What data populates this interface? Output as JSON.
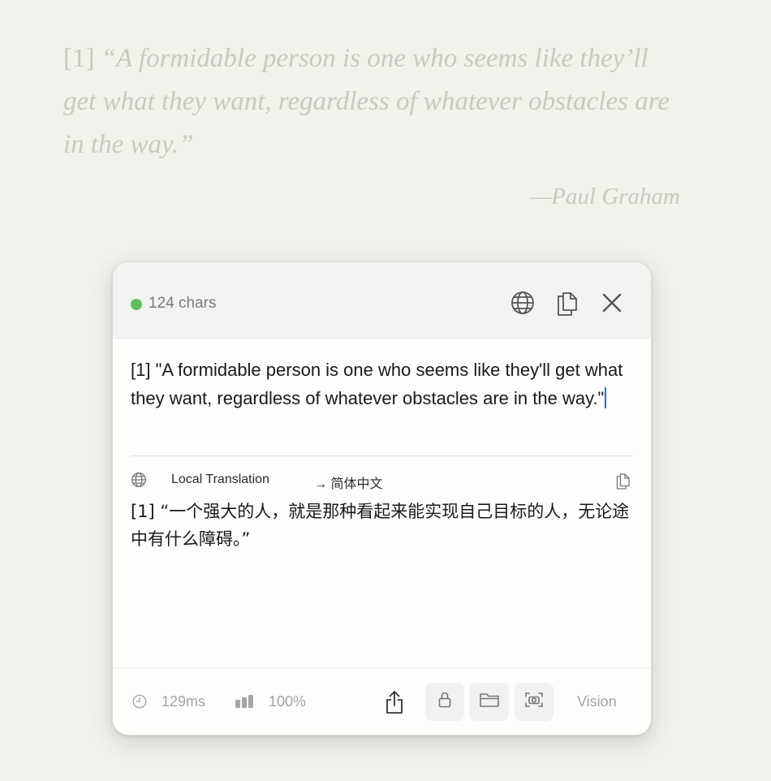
{
  "background": {
    "quote_ref": "[1]",
    "quote_text": "“A formidable person is one who seems like they’ll get what they want, regardless of whatever obstacles are in the way.”",
    "attribution": "—Paul Graham"
  },
  "panel": {
    "header": {
      "status_color": "#5fbf5f",
      "char_count": "124 chars",
      "icons": [
        "globe-icon",
        "copy-icon",
        "close-icon"
      ]
    },
    "source": {
      "text": "[1] \"A formidable person is one who seems like they'll get what they want, regardless of whatever obstacles are in the way.\""
    },
    "translation": {
      "engine_label": "Local Translation",
      "target_language": "→ 简体中文",
      "text": "[1] “一个强大的人，就是那种看起来能实现自己目标的人，无论途中有什么障碍。”"
    },
    "footer": {
      "latency": "129ms",
      "confidence": "100%",
      "mode_label": "Vision",
      "icons": [
        "clock-icon",
        "bars-icon",
        "share-icon",
        "lock-icon",
        "folder-icon",
        "camera-icon"
      ]
    }
  },
  "colors": {
    "background": "#f2f2ed",
    "accent_cursor": "#2b6de0",
    "status_green": "#5fbf5f"
  }
}
